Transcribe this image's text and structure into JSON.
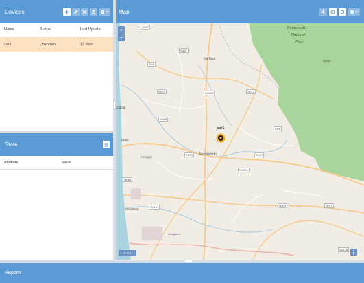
{
  "devices": {
    "title": "Devices",
    "columns": [
      "Name",
      "Status",
      "Last Update"
    ],
    "rows": [
      {
        "name": "car1",
        "status": "Unknown",
        "last_update": "12 days"
      }
    ]
  },
  "state": {
    "title": "State",
    "columns": [
      "Attribute",
      "Value"
    ]
  },
  "map": {
    "title": "Map",
    "zoom_in": "+",
    "zoom_out": "−",
    "scale_label": "5 km",
    "device_marker_label": "car1",
    "place_labels": [
      {
        "text": "Kudremukh"
      },
      {
        "text": "National"
      },
      {
        "text": "Park"
      },
      {
        "text": "Karkala"
      },
      {
        "text": "Moodabidri"
      },
      {
        "text": "Kinnigoli"
      },
      {
        "text": "Mulki"
      },
      {
        "text": "Surathkal"
      },
      {
        "text": "Mangalore"
      },
      {
        "text": "Jodidar"
      },
      {
        "text": "Ajekar"
      }
    ],
    "road_labels": [
      "SH37",
      "SH67",
      "SH1",
      "NH169",
      "SH70",
      "SH75",
      "NH66",
      "SH101",
      "SH66",
      "SH37A",
      "NH73",
      "SH70",
      "NH75",
      "SH118",
      "SH1",
      "SH67"
    ]
  },
  "reports": {
    "title": "Reports"
  },
  "colors": {
    "header": "#5b9bd5",
    "selected_row": "#fbe1c0",
    "forest": "#a9d49b",
    "map_bg": "#f1ede4"
  }
}
